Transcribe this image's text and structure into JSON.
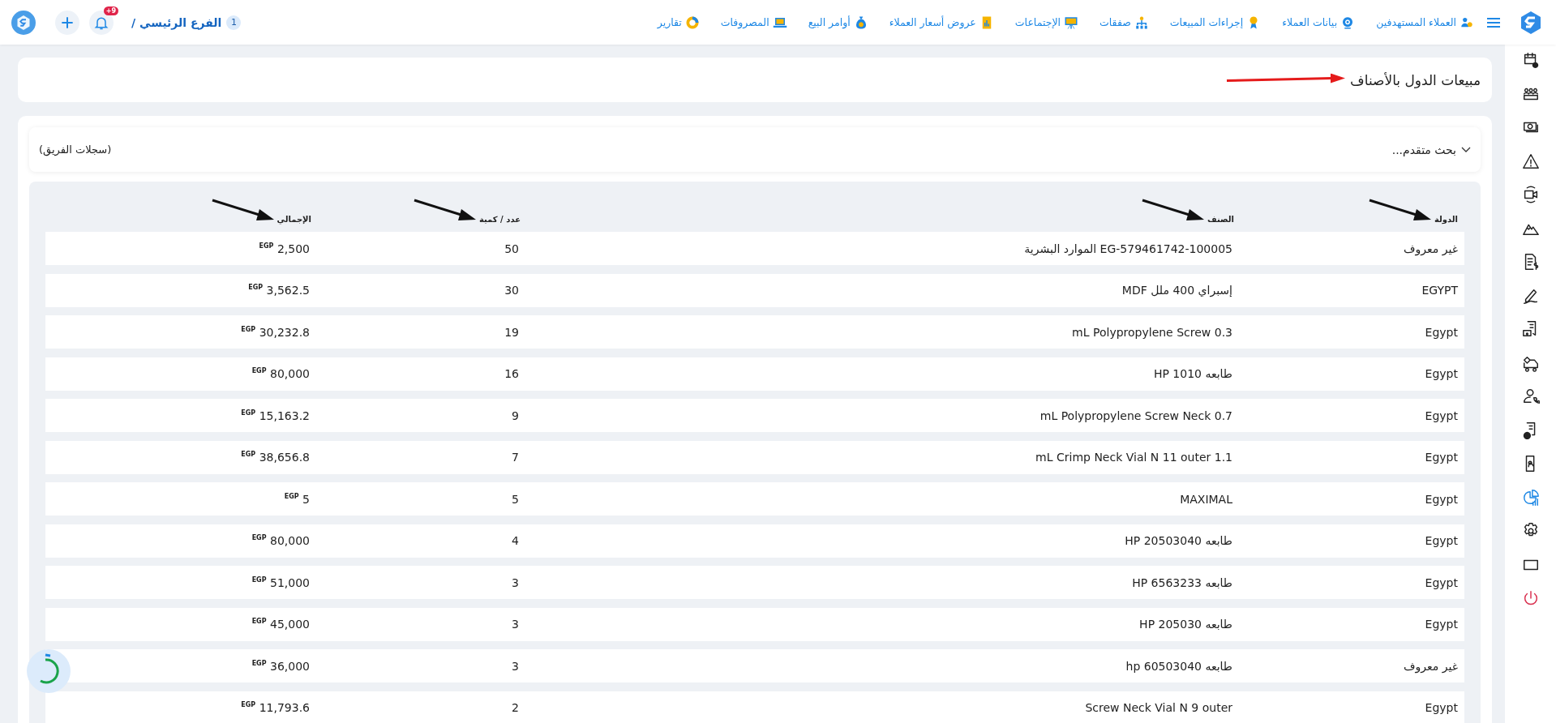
{
  "topbar": {
    "nav": [
      {
        "label": "العملاء المستهدفين"
      },
      {
        "label": "بيانات العملاء"
      },
      {
        "label": "إجراءات المبيعات"
      },
      {
        "label": "صفقات"
      },
      {
        "label": "الإجتماعات"
      },
      {
        "label": "عروض أسعار العملاء"
      },
      {
        "label": "أوامر البيع"
      },
      {
        "label": "المصروفات"
      },
      {
        "label": "تقارير"
      }
    ],
    "branch": {
      "label": "الفرع الرئيسي /",
      "count": "1"
    },
    "notifications": {
      "badge": "+9"
    }
  },
  "page_title": "مبيعات الدول بالأصناف",
  "search": {
    "label": "بحث متقدم...",
    "expanded": false,
    "team_records": "(سجلات الفريق)"
  },
  "table": {
    "columns": [
      "الدولة",
      "الصنف",
      "عدد / كمية",
      "الإجمالي"
    ],
    "rows": [
      {
        "country": "غير معروف",
        "item": "EG-579461742-100005 الموارد البشرية",
        "quantity": "50",
        "total": "$^{EGP}$ 2,500"
      },
      {
        "country": "EGYPT",
        "item": "إسبراي 400 ملل MDF",
        "quantity": "30",
        "total": "$^{EGP}$ 3,562.5"
      },
      {
        "country": "Egypt",
        "item": "mL Polypropylene Screw 0.3",
        "quantity": "19",
        "total": "$^{EGP}$ 30,232.8"
      },
      {
        "country": "Egypt",
        "item": "طابعه HP 1010",
        "quantity": "16",
        "total": "$^{EGP}$ 80,000"
      },
      {
        "country": "Egypt",
        "item": "mL Polypropylene Screw Neck 0.7",
        "quantity": "9",
        "total": "$^{EGP}$ 15,163.2"
      },
      {
        "country": "Egypt",
        "item": "mL Crimp Neck Vial N 11 outer 1.1",
        "quantity": "7",
        "total": "$^{EGP}$ 38,656.8"
      },
      {
        "country": "Egypt",
        "item": "MAXIMAL",
        "quantity": "5",
        "total": "$^{EGP}$ 5"
      },
      {
        "country": "Egypt",
        "item": "طابعه HP 20503040",
        "quantity": "4",
        "total": "$^{EGP}$ 80,000"
      },
      {
        "country": "Egypt",
        "item": "طابعه HP 6563233",
        "quantity": "3",
        "total": "$^{EGP}$ 51,000"
      },
      {
        "country": "Egypt",
        "item": "طابعه HP 205030",
        "quantity": "3",
        "total": "$^{EGP}$ 45,000"
      },
      {
        "country": "غير معروف",
        "item": "طابعه hp 60503040",
        "quantity": "3",
        "total": "$^{EGP}$ 36,000"
      },
      {
        "country": "Egypt",
        "item": "Screw Neck Vial N 9 outer",
        "quantity": "2",
        "total": "$^{EGP}$ 11,793.6"
      }
    ]
  },
  "sidebar": {
    "items": [
      {
        "selected": false
      },
      {
        "selected": false
      },
      {
        "selected": false
      },
      {
        "selected": false
      },
      {
        "selected": false
      },
      {
        "selected": false
      },
      {
        "selected": false
      },
      {
        "selected": false
      },
      {
        "selected": false
      },
      {
        "selected": false
      },
      {
        "selected": false
      },
      {
        "selected": false
      },
      {
        "selected": false
      },
      {
        "selected": true
      },
      {
        "selected": false
      },
      {
        "selected": false
      },
      {
        "selected": false
      }
    ]
  }
}
